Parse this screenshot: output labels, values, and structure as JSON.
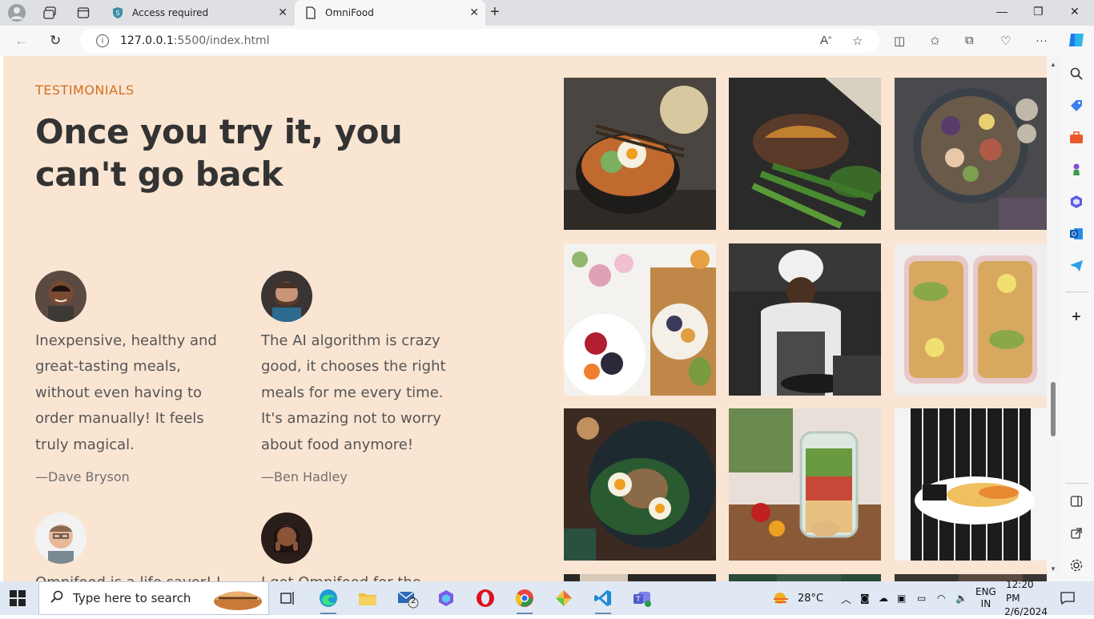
{
  "browser": {
    "tabs": [
      {
        "label": "Access required",
        "active": false
      },
      {
        "label": "OmniFood",
        "active": true
      }
    ],
    "address": {
      "host": "127.0.0.1",
      "path": ":5500/index.html"
    }
  },
  "page": {
    "subheading": "TESTIMONIALS",
    "heading": "Once you try it, you can't go back",
    "testimonials": [
      {
        "quote": "Inexpensive, healthy and great-tasting meals, without even having to order manually! It feels truly magical.",
        "author": "—Dave Bryson"
      },
      {
        "quote": "The AI algorithm is crazy good, it chooses the right meals for me every time. It's amazing not to worry about food anymore!",
        "author": "—Ben Hadley"
      },
      {
        "quote": "Omnifood is a life saver! I",
        "author": ""
      },
      {
        "quote": "I got Omnifood for the whole",
        "author": ""
      }
    ],
    "colors": {
      "background": "#fae5d3",
      "accent": "#cf711f",
      "text": "#333333"
    }
  },
  "taskbar": {
    "search_placeholder": "Type here to search",
    "weather": "28°C",
    "language": "ENG",
    "region": "IN",
    "time": "12:20 PM",
    "date": "2/6/2024",
    "mail_badge": "2"
  }
}
